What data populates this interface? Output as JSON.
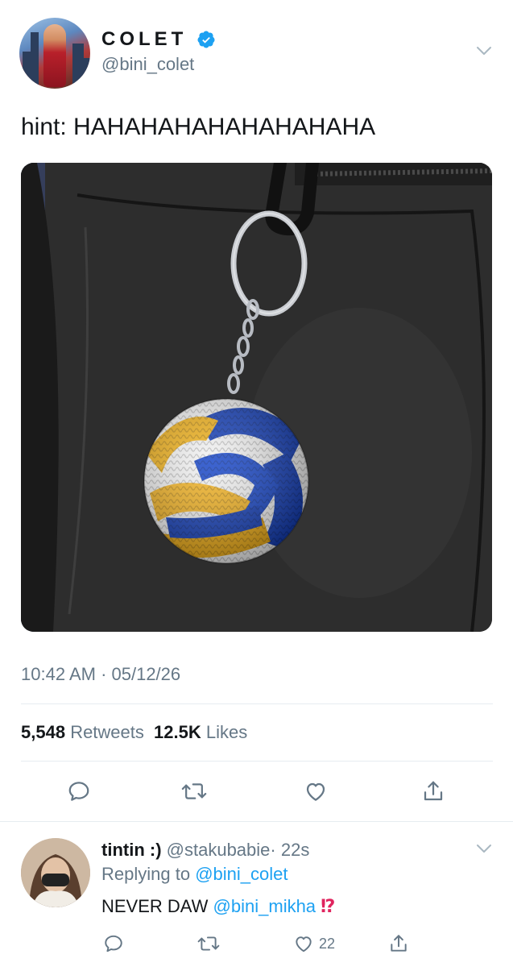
{
  "tweet": {
    "display_name": "COLET",
    "handle": "@bini_colet",
    "text": "hint: HAHAHAHAHAHAHAHAHA",
    "timestamp": "10:42 AM · 05/12/26",
    "retweets_count": "5,548",
    "retweets_label": "Retweets",
    "likes_count": "12.5K",
    "likes_label": "Likes",
    "photo_description_icon": "crochet-volleyball-keychain-photo"
  },
  "reply": {
    "display_name": "tintin :)",
    "handle": "@stakubabie",
    "time": "· 22s",
    "replying_prefix": "Replying to",
    "replying_to": "@bini_colet",
    "text_prefix": "NEVER DAW",
    "mention": "@bini_mikha",
    "emoji": "⁉",
    "like_count": "22"
  },
  "colors": {
    "accent": "#1da1f2",
    "secondary_text": "#657786",
    "primary_text": "#14171a",
    "divider": "#e6ecf0",
    "emoji_red": "#e0245e"
  }
}
